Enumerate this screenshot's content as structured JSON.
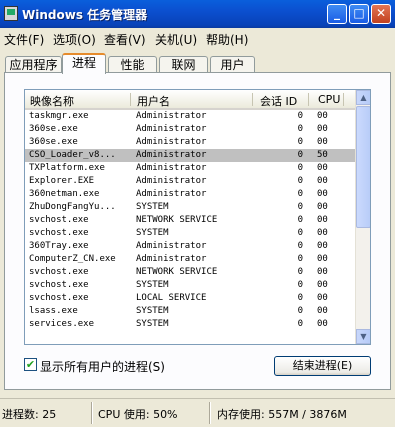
{
  "window": {
    "title": "Windows 任务管理器"
  },
  "menu": [
    "文件(F)",
    "选项(O)",
    "查看(V)",
    "关机(U)",
    "帮助(H)"
  ],
  "tabs": [
    "应用程序",
    "进程",
    "性能",
    "联网",
    "用户"
  ],
  "active_tab": "进程",
  "columns": [
    "映像名称",
    "用户名",
    "会话 ID",
    "CPU"
  ],
  "processes": [
    {
      "name": "taskmgr.exe",
      "user": "Administrator",
      "session": "0",
      "cpu": "00"
    },
    {
      "name": "360se.exe",
      "user": "Administrator",
      "session": "0",
      "cpu": "00"
    },
    {
      "name": "360se.exe",
      "user": "Administrator",
      "session": "0",
      "cpu": "00"
    },
    {
      "name": "CSO_Loader_v8...",
      "user": "Administrator",
      "session": "0",
      "cpu": "50",
      "selected": true
    },
    {
      "name": "TXPlatform.exe",
      "user": "Administrator",
      "session": "0",
      "cpu": "00"
    },
    {
      "name": "Explorer.EXE",
      "user": "Administrator",
      "session": "0",
      "cpu": "00"
    },
    {
      "name": "360netman.exe",
      "user": "Administrator",
      "session": "0",
      "cpu": "00"
    },
    {
      "name": "ZhuDongFangYu...",
      "user": "SYSTEM",
      "session": "0",
      "cpu": "00"
    },
    {
      "name": "svchost.exe",
      "user": "NETWORK SERVICE",
      "session": "0",
      "cpu": "00"
    },
    {
      "name": "svchost.exe",
      "user": "SYSTEM",
      "session": "0",
      "cpu": "00"
    },
    {
      "name": "360Tray.exe",
      "user": "Administrator",
      "session": "0",
      "cpu": "00"
    },
    {
      "name": "ComputerZ_CN.exe",
      "user": "Administrator",
      "session": "0",
      "cpu": "00"
    },
    {
      "name": "svchost.exe",
      "user": "NETWORK SERVICE",
      "session": "0",
      "cpu": "00"
    },
    {
      "name": "svchost.exe",
      "user": "SYSTEM",
      "session": "0",
      "cpu": "00"
    },
    {
      "name": "svchost.exe",
      "user": "LOCAL SERVICE",
      "session": "0",
      "cpu": "00"
    },
    {
      "name": "lsass.exe",
      "user": "SYSTEM",
      "session": "0",
      "cpu": "00"
    },
    {
      "name": "services.exe",
      "user": "SYSTEM",
      "session": "0",
      "cpu": "00"
    }
  ],
  "show_all_users": {
    "label": "显示所有用户的进程(S)",
    "checked": true
  },
  "end_process_label": "结束进程(E)",
  "status": {
    "processes": "进程数: 25",
    "cpu": "CPU 使用: 50%",
    "memory": "内存使用: 557M / 3876M"
  },
  "colors": {
    "titlebar": "#0a5fdc",
    "active_tab_accent": "#e68b2c",
    "selected_row": "#c0c0c0"
  }
}
